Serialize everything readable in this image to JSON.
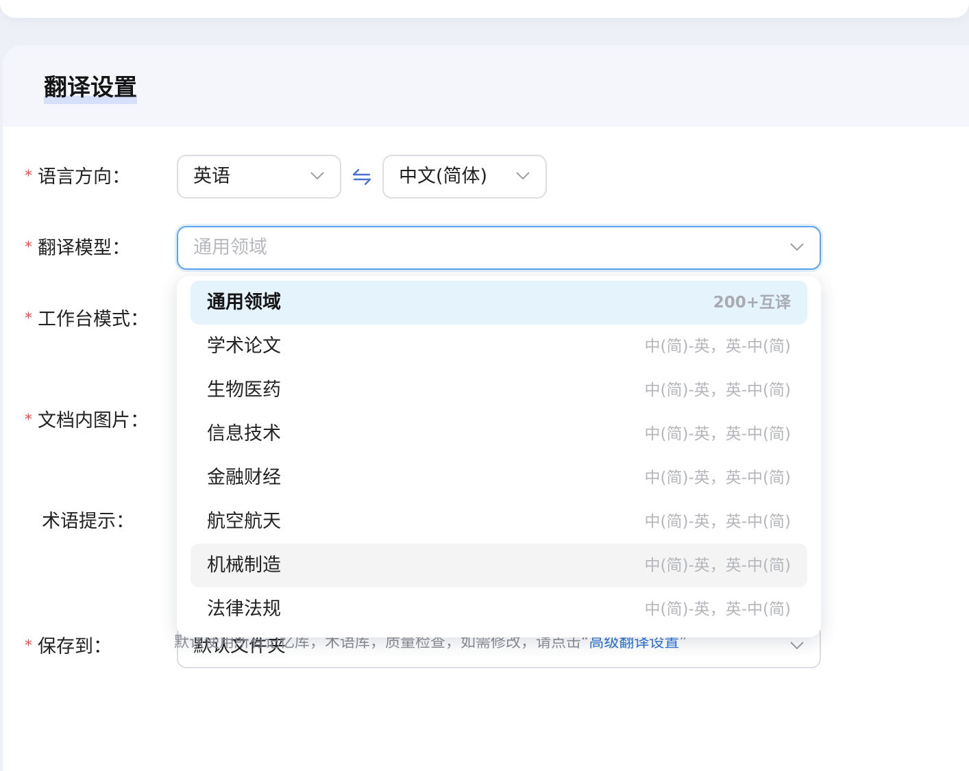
{
  "section": {
    "title": "翻译设置"
  },
  "form": {
    "language_direction": {
      "label": "语言方向：",
      "source": "英语",
      "target": "中文(简体)",
      "swap_icon": "swap-arrows-icon"
    },
    "model": {
      "label": "翻译模型：",
      "placeholder": "通用领域"
    },
    "workbench_mode": {
      "label": "工作台模式："
    },
    "doc_images": {
      "label": "文档内图片："
    },
    "term_hint": {
      "label": "术语提示："
    },
    "save_to": {
      "label": "保存到：",
      "value": "默认文件夹"
    }
  },
  "hint": {
    "text": "默认使用所有记忆库，术语库，质量检查，如需修改，请点击“",
    "link": "高级翻译设置",
    "suffix": "”"
  },
  "model_options": [
    {
      "label": "通用领域",
      "desc": "200+互译",
      "state": "selected"
    },
    {
      "label": "学术论文",
      "desc": "中(简)-英，英-中(简)",
      "state": ""
    },
    {
      "label": "生物医药",
      "desc": "中(简)-英，英-中(简)",
      "state": ""
    },
    {
      "label": "信息技术",
      "desc": "中(简)-英，英-中(简)",
      "state": ""
    },
    {
      "label": "金融财经",
      "desc": "中(简)-英，英-中(简)",
      "state": ""
    },
    {
      "label": "航空航天",
      "desc": "中(简)-英，英-中(简)",
      "state": ""
    },
    {
      "label": "机械制造",
      "desc": "中(简)-英，英-中(简)",
      "state": "hovered"
    },
    {
      "label": "法律法规",
      "desc": "中(简)-英，英-中(简)",
      "state": ""
    }
  ],
  "colors": {
    "required": "#f04a4a",
    "link": "#2f75d8",
    "focus": "#5aa4ee",
    "selected_bg": "#e5f3fd"
  }
}
